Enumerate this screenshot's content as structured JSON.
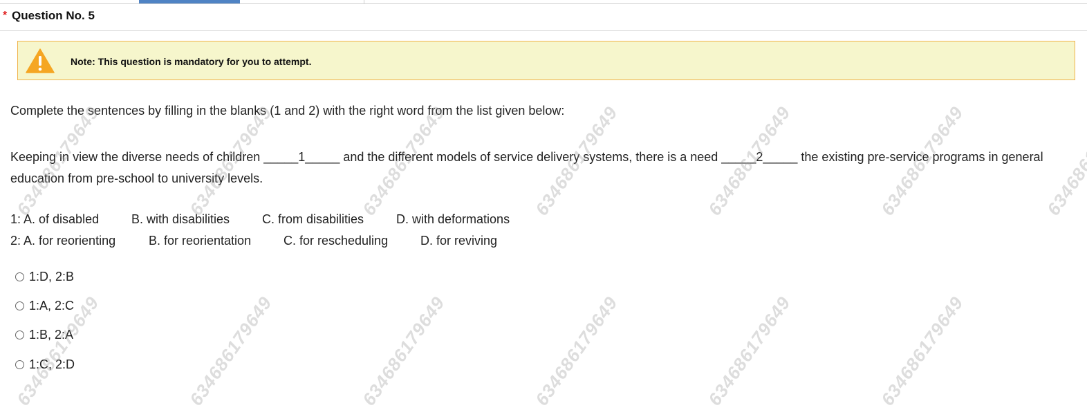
{
  "question": {
    "required_marker": "*",
    "title": "Question No. 5"
  },
  "note": {
    "icon": "warning-icon",
    "text": "Note: This question is mandatory for you to attempt."
  },
  "instruction": "Complete the sentences by filling in the blanks (1 and 2) with the right word from the list given below:",
  "stem": "Keeping in view the diverse needs of children _____1_____ and the different models of service delivery systems, there is a need _____2_____ the existing pre-service programs in general education from pre-school to university levels.",
  "options_list": {
    "row1": [
      "1: A. of disabled",
      "B. with disabilities",
      "C. from disabilities",
      "D. with deformations"
    ],
    "row2": [
      "2: A. for reorienting",
      "B. for reorientation",
      "C. for rescheduling",
      "D. for reviving"
    ]
  },
  "choices": [
    "1:D, 2:B",
    "1:A, 2:C",
    "1:B, 2:A",
    "1:C, 2:D"
  ],
  "watermark": "634686179649",
  "colors": {
    "note_bg": "#f6f6cc",
    "note_border": "#f0b24a",
    "warning": "#f5a623",
    "required": "#e02020",
    "active_tab": "#4f83c4"
  }
}
